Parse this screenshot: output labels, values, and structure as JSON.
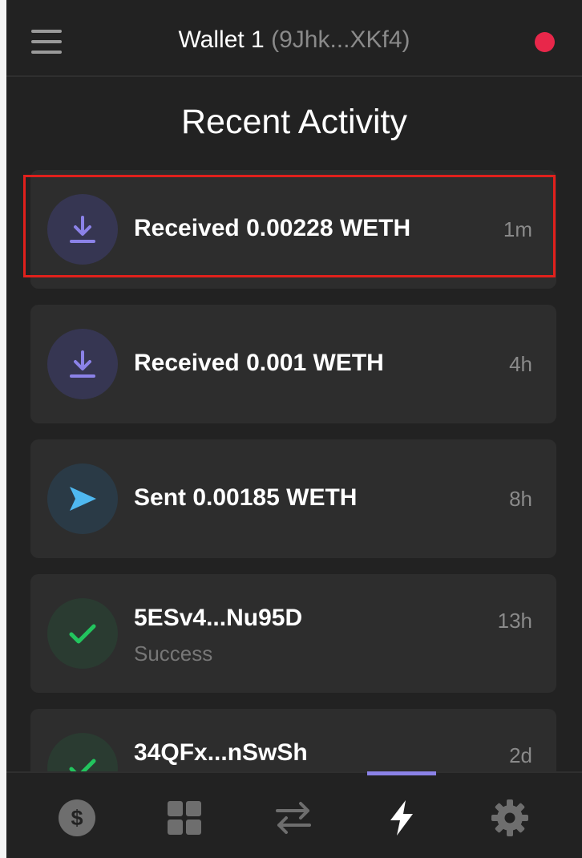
{
  "header": {
    "wallet_name": "Wallet 1",
    "wallet_address": "(9Jhk...XKf4)",
    "menu_icon": "hamburger-icon",
    "status_color": "#e8274a"
  },
  "page": {
    "title": "Recent Activity"
  },
  "activities": [
    {
      "title": "Received 0.00228 WETH",
      "time": "1m",
      "subtitle": "",
      "icon": "download-icon",
      "type": "received"
    },
    {
      "title": "Received 0.001 WETH",
      "time": "4h",
      "subtitle": "",
      "icon": "download-icon",
      "type": "received"
    },
    {
      "title": "Sent 0.00185 WETH",
      "time": "8h",
      "subtitle": "",
      "icon": "send-icon",
      "type": "sent"
    },
    {
      "title": "5ESv4...Nu95D",
      "time": "13h",
      "subtitle": "Success",
      "icon": "check-icon",
      "type": "success"
    },
    {
      "title": "34QFx...nSwSh",
      "time": "2d",
      "subtitle": "",
      "icon": "check-icon",
      "type": "success"
    }
  ],
  "nav": {
    "tabs": [
      {
        "icon": "dollar-coin-icon",
        "active": false
      },
      {
        "icon": "grid-icon",
        "active": false
      },
      {
        "icon": "swap-arrows-icon",
        "active": false
      },
      {
        "icon": "lightning-icon",
        "active": true
      },
      {
        "icon": "gear-icon",
        "active": false
      }
    ],
    "active_color": "#8b82e8"
  },
  "colors": {
    "background": "#222222",
    "card": "#2d2d2d",
    "received_accent": "#8b82e8",
    "sent_accent": "#4fb8f0",
    "success_accent": "#22c55e",
    "highlight_border": "#e0201c"
  }
}
